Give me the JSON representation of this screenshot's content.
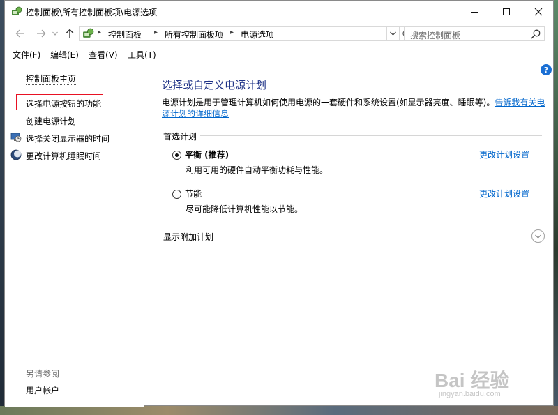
{
  "window": {
    "title": "控制面板\\所有控制面板项\\电源选项"
  },
  "address_bar": {
    "crumbs": [
      "控制面板",
      "所有控制面板项",
      "电源选项"
    ]
  },
  "search": {
    "placeholder": "搜索控制面板"
  },
  "menu": {
    "items": [
      "文件(F)",
      "编辑(E)",
      "查看(V)",
      "工具(T)"
    ]
  },
  "left_pane": {
    "home": "控制面板主页",
    "items": [
      "选择电源按钮的功能",
      "创建电源计划",
      "选择关闭显示器的时间",
      "更改计算机睡眠时间"
    ],
    "see_also_label": "另请参阅",
    "see_also_items": [
      "用户帐户"
    ]
  },
  "main": {
    "title": "选择或自定义电源计划",
    "description": "电源计划是用于管理计算机如何使用电源的一套硬件和系统设置(如显示器亮度、睡眠等)。",
    "more_link": "告诉我有关电源计划的详细信息",
    "section_label": "首选计划",
    "plans": [
      {
        "name": "平衡 (推荐)",
        "description": "利用可用的硬件自动平衡功耗与性能。",
        "link": "更改计划设置",
        "selected": true
      },
      {
        "name": "节能",
        "description": "尽可能降低计算机性能以节能。",
        "link": "更改计划设置",
        "selected": false
      }
    ],
    "extra_plans_label": "显示附加计划"
  },
  "watermark": {
    "main": "Bai 经验",
    "sub": "jingyan.baidu.com"
  },
  "colors": {
    "title_blue": "#1e3287",
    "link_blue": "#0066cc",
    "highlight_red": "#e81123",
    "help_blue": "#1a6fd4"
  }
}
